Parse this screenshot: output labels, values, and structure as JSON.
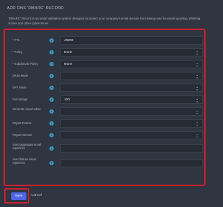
{
  "page": {
    "title": "ADD DNS 'DMARC' RECORD",
    "description": "'DMARC' Record is an email validation system designed to protect your company's email domain from being used for email spoofing, phishing scams and other cybercrimes."
  },
  "form": {
    "fields": [
      {
        "label": "* TTL",
        "value": "43200",
        "dropdown": false
      },
      {
        "label": "* Policy",
        "value": "None",
        "dropdown": true
      },
      {
        "label": "* Subdomain Policy",
        "value": "None",
        "dropdown": true
      },
      {
        "label": "DKIM Mode",
        "value": "",
        "dropdown": true
      },
      {
        "label": "SPF Mode",
        "value": "",
        "dropdown": true
      },
      {
        "label": "Percentage",
        "value": "100",
        "dropdown": true
      },
      {
        "label": "Generate report when",
        "value": "",
        "dropdown": true
      },
      {
        "label": "Report Format",
        "value": "",
        "dropdown": true
      },
      {
        "label": "Report Interval",
        "value": "",
        "dropdown": true
      },
      {
        "label": "Send aggregate email reports to",
        "value": "",
        "dropdown": false
      },
      {
        "label": "Send failure email reports to",
        "value": "",
        "dropdown": false
      }
    ]
  },
  "actions": {
    "save_label": "Save",
    "cancel_label": "Cancel"
  },
  "colors": {
    "background": "#2f3541",
    "input_bg": "#262b34",
    "accent": "#4e66e4",
    "help_icon": "#3ba0c6",
    "highlight": "#d21f2c"
  }
}
